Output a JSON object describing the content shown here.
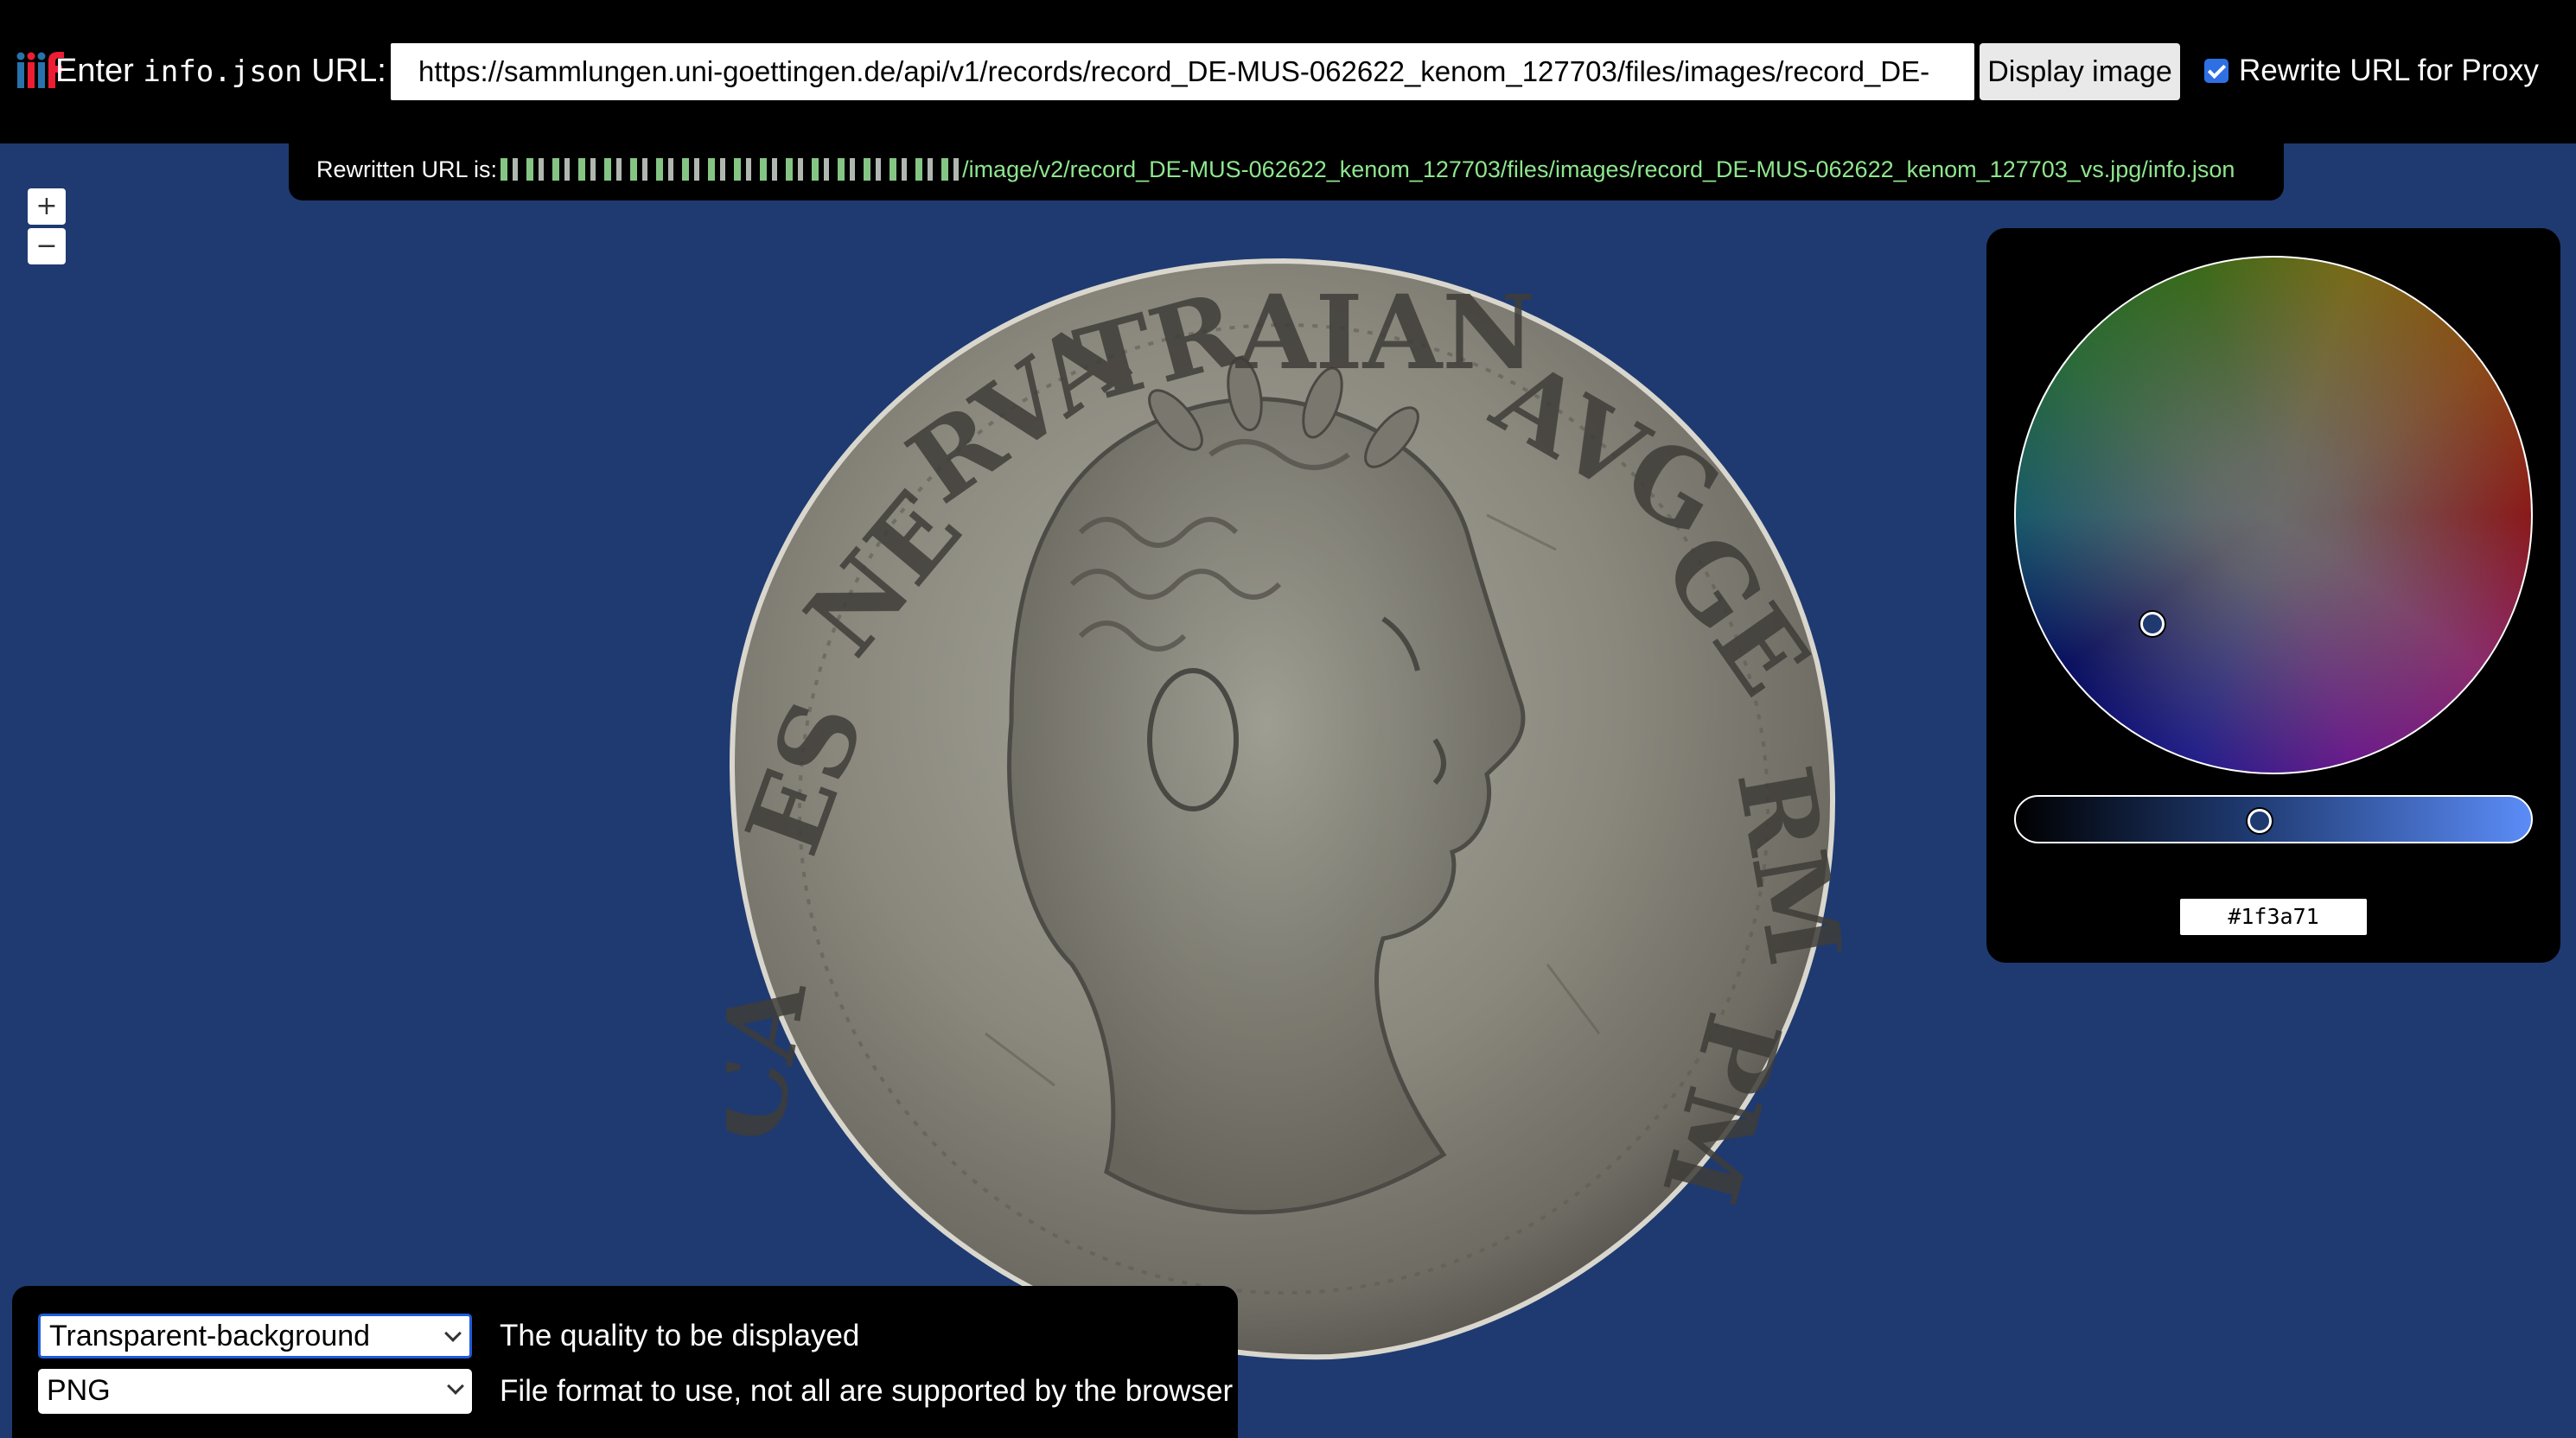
{
  "header": {
    "label_prefix": "Enter",
    "label_code": "info.json",
    "label_suffix": "URL:",
    "url_value": "https://sammlungen.uni-goettingen.de/api/v1/records/record_DE-MUS-062622_kenom_127703/files/images/record_DE-",
    "display_button": "Display image",
    "proxy_checked": true,
    "proxy_label": "Rewrite URL for Proxy"
  },
  "rewritten": {
    "prefix": "Rewritten URL is:",
    "path": "/image/v2/record_DE-MUS-062622_kenom_127703/files/images/record_DE-MUS-062622_kenom_127703_vs.jpg/info.json"
  },
  "zoom": {
    "in_label": "+",
    "out_label": "−"
  },
  "color_picker": {
    "hex_value": "#1f3a71",
    "background_color": "#1f3a71"
  },
  "coin": {
    "legend_text": "IMP CAES NERVA TRAIAN AVG GERM"
  },
  "controls": {
    "quality": {
      "selected": "Transparent-background",
      "description": "The quality to be displayed"
    },
    "format": {
      "selected": "PNG",
      "description": "File format to use, not all are supported by the browser"
    }
  }
}
